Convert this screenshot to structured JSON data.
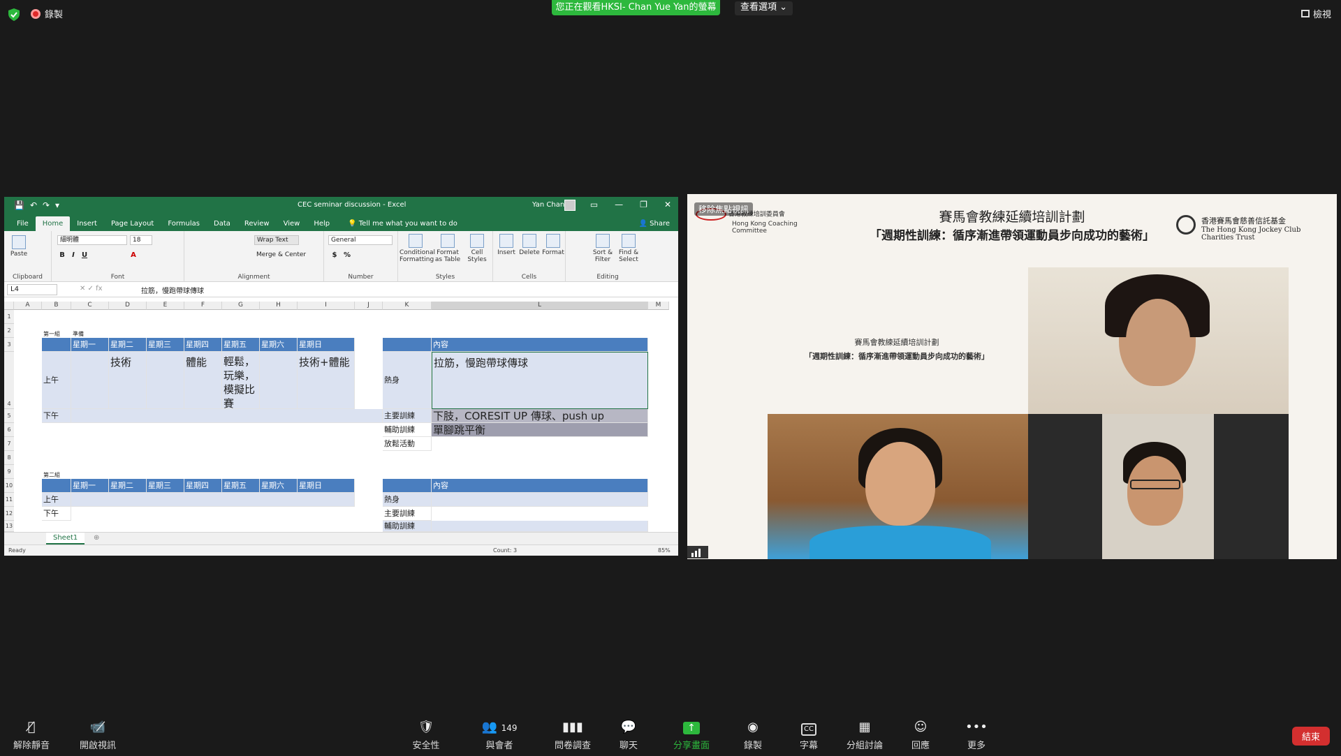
{
  "top": {
    "recording_label": "錄製",
    "share_banner": "您正在觀看HKSI- Chan Yue Yan的螢幕",
    "view_options": "查看選項 ⌄",
    "view_button": "檢視"
  },
  "excel": {
    "doc_title": "CEC seminar discussion  -  Excel",
    "user": "Yan Chan",
    "tabs": [
      "File",
      "Home",
      "Insert",
      "Page Layout",
      "Formulas",
      "Data",
      "Review",
      "View",
      "Help"
    ],
    "tell_me": "Tell me what you want to do",
    "share": "Share",
    "ribbon": {
      "paste": "Paste",
      "clipboard": "Clipboard",
      "font_name": "細明體",
      "font_size": "18",
      "font_group": "Font",
      "wrap_text": "Wrap Text",
      "merge_center": "Merge & Center",
      "alignment": "Alignment",
      "number_format": "General",
      "number": "Number",
      "conditional": "Conditional Formatting",
      "format_table": "Format as Table",
      "cell_styles": "Cell Styles",
      "styles": "Styles",
      "insert": "Insert",
      "delete": "Delete",
      "format": "Format",
      "cells": "Cells",
      "sort_filter": "Sort & Filter",
      "find_select": "Find & Select",
      "editing": "Editing"
    },
    "name_box": "L4",
    "formula": "拉筋，慢跑帶球傳球",
    "columns": [
      "A",
      "B",
      "C",
      "D",
      "E",
      "F",
      "G",
      "H",
      "I",
      "J",
      "K",
      "L",
      "M"
    ],
    "rows": [
      "1",
      "2",
      "3",
      "4",
      "5",
      "6",
      "7",
      "8",
      "9",
      "10",
      "11",
      "12",
      "13"
    ],
    "group1": "第一組",
    "prep": "準備",
    "group2": "第二組",
    "days": [
      "星期一",
      "星期二",
      "星期三",
      "星期四",
      "星期五",
      "星期六",
      "星期日"
    ],
    "content_hdr": "內容",
    "am": "上午",
    "pm": "下午",
    "d4": "技術",
    "f4": "體能",
    "g4": "輕鬆，玩樂，模擬比賽",
    "i4": "技術+體能",
    "warmup": "熱身",
    "main_training": "主要訓練",
    "aux_training": "輔助訓練",
    "relax": "放鬆活動",
    "l4": "拉筋，慢跑帶球傳球",
    "l5": "下肢，CORESIT UP 傳球、push up",
    "l6": "單腳跳平衡",
    "sheet": "Sheet1",
    "status_ready": "Ready",
    "count": "Count: 3",
    "zoom": "85%"
  },
  "slide": {
    "watch_chip": "移除焦點視訊",
    "title1": "賽馬會教練延續培訓計劃",
    "title2": "「週期性訓練：循序漸進帶領運動員步向成功的藝術」",
    "left_org": "香港教練培訓委員會",
    "left_org_en": "Hong Kong Coaching Committee",
    "right_org": "香港賽馬會慈善信託基金",
    "right_org_en": "The Hong Kong Jockey Club Charities Trust",
    "mini_title1": "賽馬會教練延續培訓計劃",
    "mini_title2": "「週期性訓練：循序漸進帶領運動員步向成功的藝術」"
  },
  "toolbar": {
    "unmute": "解除靜音",
    "start_video": "開啟視訊",
    "security": "安全性",
    "participants": "與會者",
    "participants_count": "149",
    "polls": "問卷調查",
    "chat": "聊天",
    "share_screen": "分享畫面",
    "record": "錄製",
    "captions": "字幕",
    "breakout": "分組討論",
    "reactions": "回應",
    "more": "更多",
    "end": "結束"
  }
}
